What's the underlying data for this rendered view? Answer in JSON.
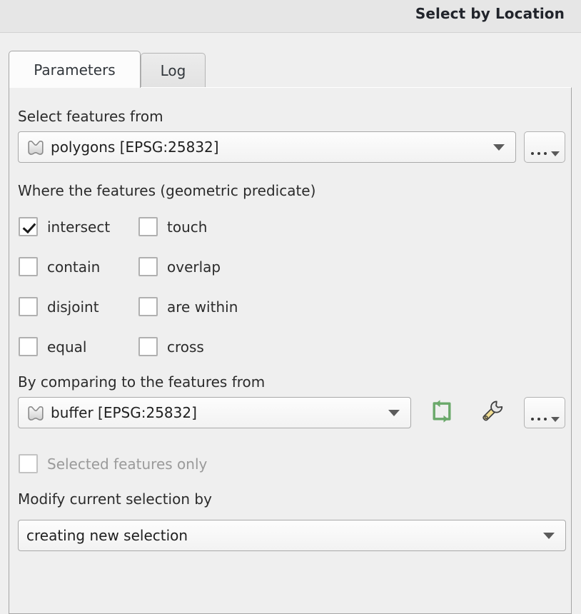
{
  "window": {
    "title": "Select by Location"
  },
  "tabs": [
    {
      "label": "Parameters",
      "active": true
    },
    {
      "label": "Log",
      "active": false
    }
  ],
  "parameters": {
    "input_layer": {
      "label": "Select features from",
      "value": "polygons [EPSG:25832]",
      "icon": "polygon-layer-icon",
      "more_button": "..."
    },
    "predicate": {
      "label": "Where the features (geometric predicate)",
      "options": [
        {
          "label": "intersect",
          "checked": true
        },
        {
          "label": "touch",
          "checked": false
        },
        {
          "label": "contain",
          "checked": false
        },
        {
          "label": "overlap",
          "checked": false
        },
        {
          "label": "disjoint",
          "checked": false
        },
        {
          "label": "are within",
          "checked": false
        },
        {
          "label": "equal",
          "checked": false
        },
        {
          "label": "cross",
          "checked": false
        }
      ]
    },
    "intersect_layer": {
      "label": "By comparing to the features from",
      "value": "buffer [EPSG:25832]",
      "icon": "polygon-layer-icon",
      "refresh_button": "refresh-icon",
      "wrench_button": "wrench-icon",
      "more_button": "..."
    },
    "selected_only": {
      "label": "Selected features only",
      "checked": false,
      "enabled": false
    },
    "method": {
      "label": "Modify current selection by",
      "value": "creating new selection"
    }
  },
  "colors": {
    "window_background": "#efefef",
    "titlebar_background": "#e6e6e6",
    "title_text": "#21242b",
    "refresh_icon": "#6aa86a",
    "wrench_handle": "#f2de92",
    "wrench_head": "#4a4a4a"
  }
}
